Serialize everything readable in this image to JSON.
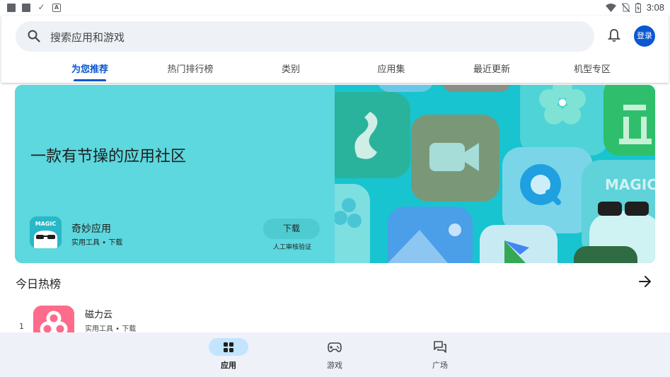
{
  "status_bar": {
    "time": "3:08"
  },
  "search": {
    "placeholder": "搜索应用和游戏"
  },
  "header": {
    "login_label": "登录"
  },
  "tabs": [
    {
      "label": "为您推荐",
      "active": true
    },
    {
      "label": "热门排行榜",
      "active": false
    },
    {
      "label": "类别",
      "active": false
    },
    {
      "label": "应用集",
      "active": false
    },
    {
      "label": "最近更新",
      "active": false
    },
    {
      "label": "机型专区",
      "active": false
    }
  ],
  "banner": {
    "title": "一款有节操的应用社区",
    "app_name": "奇妙应用",
    "app_meta": "实用工具 • 下载",
    "icon_text": "MAGIC",
    "art_icon_text": "MAGIC",
    "download_label": "下载",
    "download_note": "人工审核验证"
  },
  "hot_section": {
    "title": "今日热榜",
    "items": [
      {
        "rank": "1",
        "name": "磁力云",
        "meta": "实用工具 • 下载"
      }
    ]
  },
  "bottom_nav": [
    {
      "label": "应用",
      "icon": "apps-grid-icon",
      "active": true
    },
    {
      "label": "游戏",
      "icon": "gamepad-icon",
      "active": false
    },
    {
      "label": "广场",
      "icon": "forum-icon",
      "active": false
    }
  ],
  "colors": {
    "accent": "#0b57d0",
    "banner_bg": "#5cd8de",
    "banner_art_bg": "#18c4cf",
    "nav_bg": "#eef1f7",
    "nav_active_pill": "#c3e4ff"
  }
}
